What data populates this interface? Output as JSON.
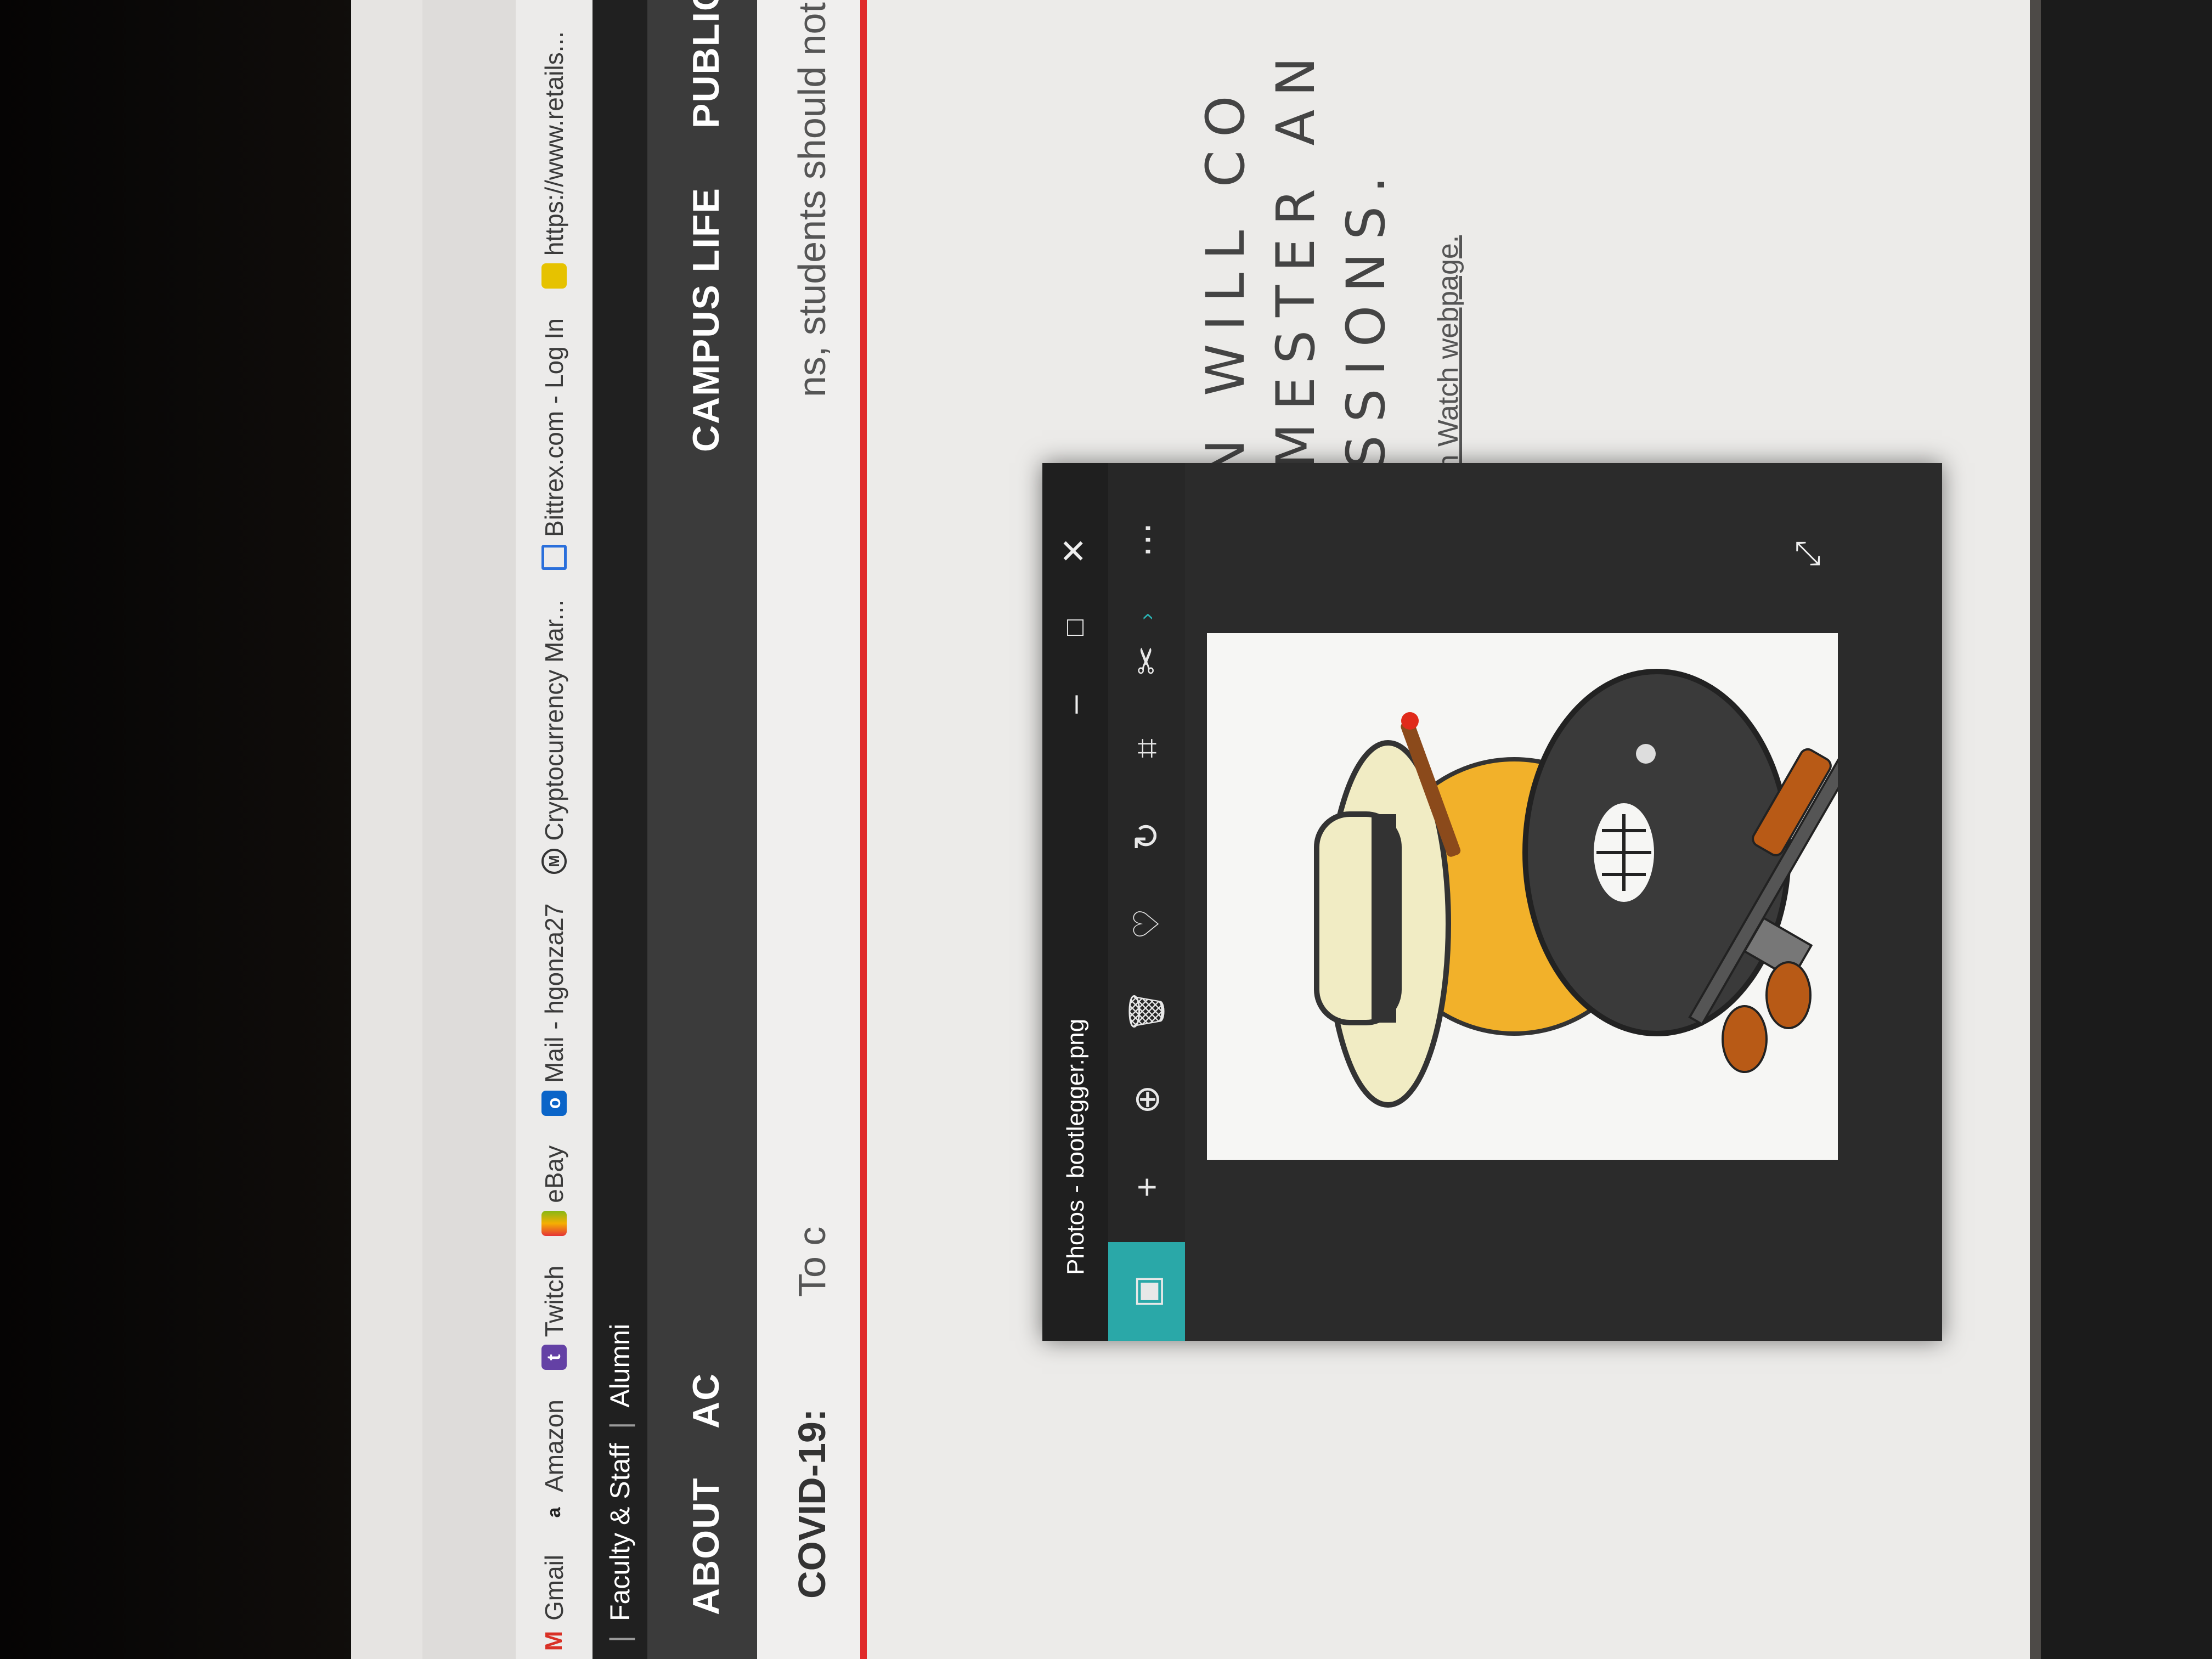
{
  "bookmarks": [
    {
      "label": "Gmail",
      "icon": "gmail-icon",
      "color": "#d93025",
      "glyph": "M"
    },
    {
      "label": "Amazon",
      "icon": "amazon-icon",
      "color": "#222222",
      "glyph": "a"
    },
    {
      "label": "Twitch",
      "icon": "twitch-icon",
      "color": "#6441a5",
      "glyph": "t"
    },
    {
      "label": "eBay",
      "icon": "ebay-icon",
      "color": "#e53238",
      "glyph": "e"
    },
    {
      "label": "Mail - hgonza27",
      "icon": "outlook-icon",
      "color": "#0a64c8",
      "glyph": "o"
    },
    {
      "label": "Cryptocurrency Mar...",
      "icon": "coinmarketcap-icon",
      "color": "#333333",
      "glyph": "◎"
    },
    {
      "label": "Bittrex.com - Log In",
      "icon": "bittrex-icon",
      "color": "#2a6fdb",
      "glyph": "⧉"
    },
    {
      "label": "https://www.retails...",
      "icon": "page-icon",
      "color": "#e6c200",
      "glyph": "▦"
    }
  ],
  "topbar": {
    "faculty": "Faculty & Staff",
    "alumni": "Alumni",
    "sep": "|"
  },
  "nav": {
    "about": "ABOUT",
    "ac": "AC",
    "campus_life": "CAMPUS LIFE",
    "public": "PUBLIC"
  },
  "covid": {
    "label": "COVID-19:",
    "text_a": "To c",
    "text_b": "ns, students should not c"
  },
  "notice": {
    "line1": "ION WILL CO",
    "line2": "SEMESTER AN",
    "line3": "SESSIONS."
  },
  "info_link": "For more information, visit our Health Watch webpage.",
  "photos": {
    "title": "Photos - bootlegger.png",
    "image_alt": "bootlegger cartoon"
  }
}
